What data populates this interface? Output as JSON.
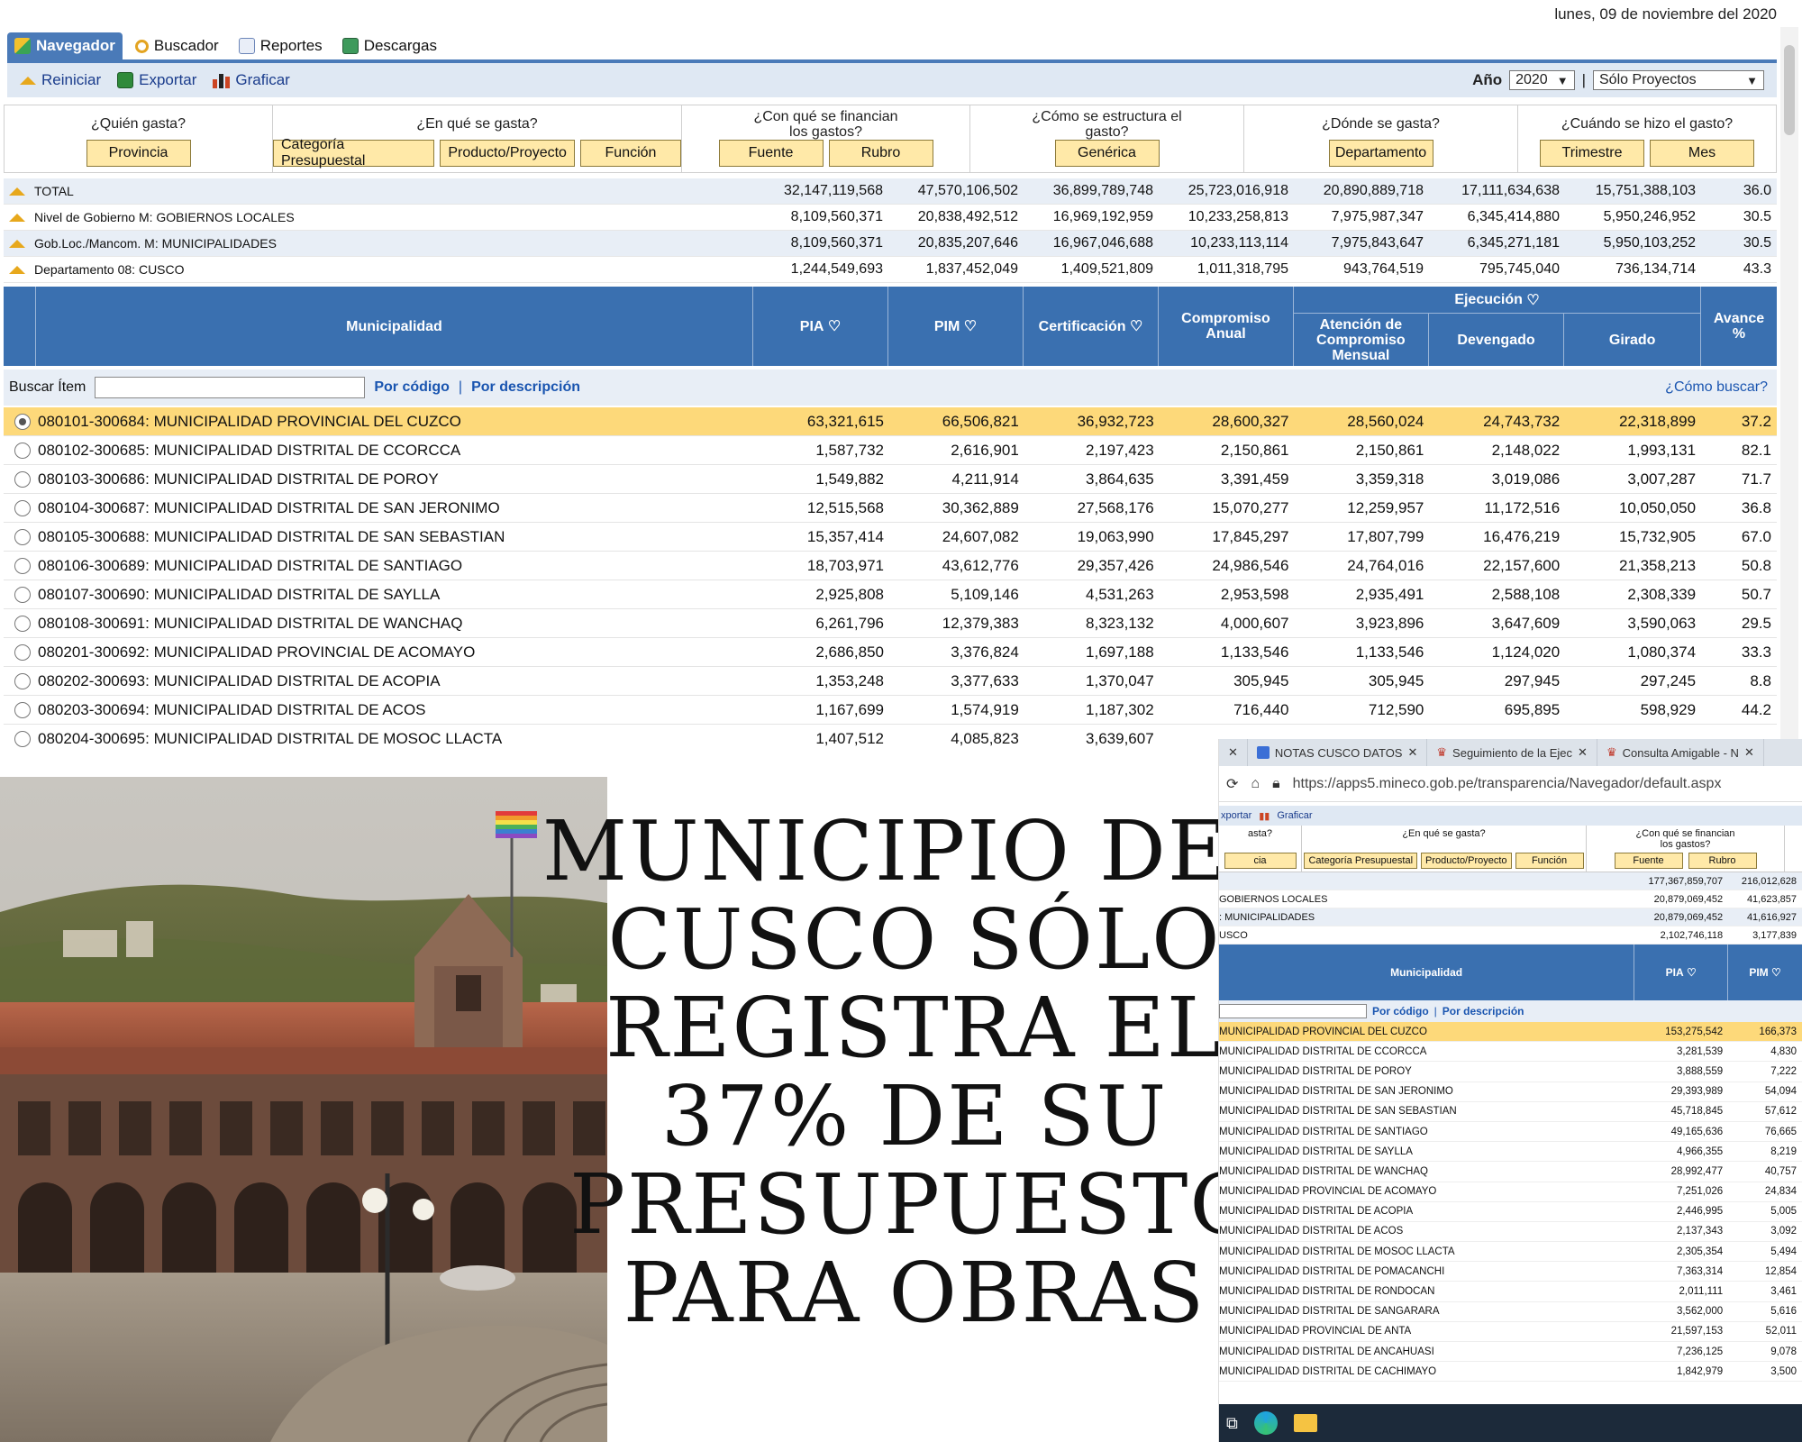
{
  "header": {
    "date": "lunes, 09 de noviembre del 2020"
  },
  "tabs": [
    "Navegador",
    "Buscador",
    "Reportes",
    "Descargas"
  ],
  "toolbar": {
    "reiniciar": "Reiniciar",
    "exportar": "Exportar",
    "graficar": "Graficar",
    "year_label": "Año",
    "year_value": "2020",
    "separator": "|",
    "scope_value": "Sólo Proyectos"
  },
  "questions": [
    {
      "title": "¿Quién gasta?",
      "buttons": [
        "Provincia"
      ]
    },
    {
      "title": "¿En qué se gasta?",
      "buttons": [
        "Categoría Presupuestal",
        "Producto/Proyecto",
        "Función"
      ]
    },
    {
      "title": "¿Con qué se financian los gastos?",
      "buttons": [
        "Fuente",
        "Rubro"
      ]
    },
    {
      "title": "¿Cómo se estructura el gasto?",
      "buttons": [
        "Genérica"
      ]
    },
    {
      "title": "¿Dónde se gasta?",
      "buttons": [
        "Departamento"
      ]
    },
    {
      "title": "¿Cuándo se hizo el gasto?",
      "buttons": [
        "Trimestre",
        "Mes"
      ]
    }
  ],
  "totals": [
    {
      "label": "TOTAL",
      "v": [
        "32,147,119,568",
        "47,570,106,502",
        "36,899,789,748",
        "25,723,016,918",
        "20,890,889,718",
        "17,111,634,638",
        "15,751,388,103",
        "36.0"
      ]
    },
    {
      "label": "Nivel de Gobierno M: GOBIERNOS LOCALES",
      "v": [
        "8,109,560,371",
        "20,838,492,512",
        "16,969,192,959",
        "10,233,258,813",
        "7,975,987,347",
        "6,345,414,880",
        "5,950,246,952",
        "30.5"
      ]
    },
    {
      "label": "Gob.Loc./Mancom. M: MUNICIPALIDADES",
      "v": [
        "8,109,560,371",
        "20,835,207,646",
        "16,967,046,688",
        "10,233,113,114",
        "7,975,843,647",
        "6,345,271,181",
        "5,950,103,252",
        "30.5"
      ]
    },
    {
      "label": "Departamento 08: CUSCO",
      "v": [
        "1,244,549,693",
        "1,837,452,049",
        "1,409,521,809",
        "1,011,318,795",
        "943,764,519",
        "795,745,040",
        "736,134,714",
        "43.3"
      ]
    }
  ],
  "table_headers": {
    "municipalidad": "Municipalidad",
    "pia": "PIA",
    "pim": "PIM",
    "certificacion": "Certificación",
    "compromiso_anual": "Compromiso Anual",
    "ejecucion": "Ejecución",
    "atencion": "Atención de Compromiso Mensual",
    "devengado": "Devengado",
    "girado": "Girado",
    "avance": "Avance %"
  },
  "search": {
    "label": "Buscar Ítem",
    "by_code": "Por código",
    "sep": "|",
    "by_desc": "Por descripción",
    "help": "¿Cómo buscar?"
  },
  "rows": [
    {
      "name": "080101-300684: MUNICIPALIDAD PROVINCIAL DEL CUZCO",
      "v": [
        "63,321,615",
        "66,506,821",
        "36,932,723",
        "28,600,327",
        "28,560,024",
        "24,743,732",
        "22,318,899",
        "37.2"
      ]
    },
    {
      "name": "080102-300685: MUNICIPALIDAD DISTRITAL DE CCORCCA",
      "v": [
        "1,587,732",
        "2,616,901",
        "2,197,423",
        "2,150,861",
        "2,150,861",
        "2,148,022",
        "1,993,131",
        "82.1"
      ]
    },
    {
      "name": "080103-300686: MUNICIPALIDAD DISTRITAL DE POROY",
      "v": [
        "1,549,882",
        "4,211,914",
        "3,864,635",
        "3,391,459",
        "3,359,318",
        "3,019,086",
        "3,007,287",
        "71.7"
      ]
    },
    {
      "name": "080104-300687: MUNICIPALIDAD DISTRITAL DE SAN JERONIMO",
      "v": [
        "12,515,568",
        "30,362,889",
        "27,568,176",
        "15,070,277",
        "12,259,957",
        "11,172,516",
        "10,050,050",
        "36.8"
      ]
    },
    {
      "name": "080105-300688: MUNICIPALIDAD DISTRITAL DE SAN SEBASTIAN",
      "v": [
        "15,357,414",
        "24,607,082",
        "19,063,990",
        "17,845,297",
        "17,807,799",
        "16,476,219",
        "15,732,905",
        "67.0"
      ]
    },
    {
      "name": "080106-300689: MUNICIPALIDAD DISTRITAL DE SANTIAGO",
      "v": [
        "18,703,971",
        "43,612,776",
        "29,357,426",
        "24,986,546",
        "24,764,016",
        "22,157,600",
        "21,358,213",
        "50.8"
      ]
    },
    {
      "name": "080107-300690: MUNICIPALIDAD DISTRITAL DE SAYLLA",
      "v": [
        "2,925,808",
        "5,109,146",
        "4,531,263",
        "2,953,598",
        "2,935,491",
        "2,588,108",
        "2,308,339",
        "50.7"
      ]
    },
    {
      "name": "080108-300691: MUNICIPALIDAD DISTRITAL DE WANCHAQ",
      "v": [
        "6,261,796",
        "12,379,383",
        "8,323,132",
        "4,000,607",
        "3,923,896",
        "3,647,609",
        "3,590,063",
        "29.5"
      ]
    },
    {
      "name": "080201-300692: MUNICIPALIDAD PROVINCIAL DE ACOMAYO",
      "v": [
        "2,686,850",
        "3,376,824",
        "1,697,188",
        "1,133,546",
        "1,133,546",
        "1,124,020",
        "1,080,374",
        "33.3"
      ]
    },
    {
      "name": "080202-300693: MUNICIPALIDAD DISTRITAL DE ACOPIA",
      "v": [
        "1,353,248",
        "3,377,633",
        "1,370,047",
        "305,945",
        "305,945",
        "297,945",
        "297,245",
        "8.8"
      ]
    },
    {
      "name": "080203-300694: MUNICIPALIDAD DISTRITAL DE ACOS",
      "v": [
        "1,167,699",
        "1,574,919",
        "1,187,302",
        "716,440",
        "712,590",
        "695,895",
        "598,929",
        "44.2"
      ]
    },
    {
      "name": "080204-300695: MUNICIPALIDAD DISTRITAL DE MOSOC LLACTA",
      "v": [
        "1,407,512",
        "4,085,823",
        "3,639,607",
        "",
        "",
        "",
        "",
        ""
      ]
    }
  ],
  "headline": [
    "MUNICIPIO DEL",
    "CUSCO SÓLO",
    "REGISTRA EL",
    "37% DE SU",
    "PRESUPUESTO",
    "PARA OBRAS"
  ],
  "browser": {
    "tabs": [
      "NOTAS CUSCO DATOS",
      "Seguimiento de la Ejec",
      "Consulta Amigable - N"
    ],
    "url": "https://apps5.mineco.gob.pe/transparencia/Navegador/default.aspx",
    "toolbar": [
      "xportar",
      "Graficar"
    ],
    "q_titles": [
      "asta?",
      "¿En qué se gasta?",
      "¿Con qué se financian los gastos?"
    ],
    "q_buttons": [
      "cia",
      "Categoría Presupuestal",
      "Producto/Proyecto",
      "Función",
      "Fuente",
      "Rubro"
    ],
    "totals": [
      {
        "label": "",
        "pia": "177,367,859,707",
        "pim": "216,012,628"
      },
      {
        "label": "GOBIERNOS LOCALES",
        "pia": "20,879,069,452",
        "pim": "41,623,857"
      },
      {
        "label": ": MUNICIPALIDADES",
        "pia": "20,879,069,452",
        "pim": "41,616,927"
      },
      {
        "label": "USCO",
        "pia": "2,102,746,118",
        "pim": "3,177,839"
      }
    ],
    "head": {
      "municipalidad": "Municipalidad",
      "pia": "PIA",
      "pim": "PIM"
    },
    "search": {
      "by_code": "Por código",
      "sep": "|",
      "by_desc": "Por descripción"
    },
    "rows": [
      {
        "name": "MUNICIPALIDAD PROVINCIAL DEL CUZCO",
        "pia": "153,275,542",
        "pim": "166,373"
      },
      {
        "name": "MUNICIPALIDAD DISTRITAL DE CCORCCA",
        "pia": "3,281,539",
        "pim": "4,830"
      },
      {
        "name": "MUNICIPALIDAD DISTRITAL DE POROY",
        "pia": "3,888,559",
        "pim": "7,222"
      },
      {
        "name": "MUNICIPALIDAD DISTRITAL DE SAN JERONIMO",
        "pia": "29,393,989",
        "pim": "54,094"
      },
      {
        "name": "MUNICIPALIDAD DISTRITAL DE SAN SEBASTIAN",
        "pia": "45,718,845",
        "pim": "57,612"
      },
      {
        "name": "MUNICIPALIDAD DISTRITAL DE SANTIAGO",
        "pia": "49,165,636",
        "pim": "76,665"
      },
      {
        "name": "MUNICIPALIDAD DISTRITAL DE SAYLLA",
        "pia": "4,966,355",
        "pim": "8,219"
      },
      {
        "name": "MUNICIPALIDAD DISTRITAL DE WANCHAQ",
        "pia": "28,992,477",
        "pim": "40,757"
      },
      {
        "name": "MUNICIPALIDAD PROVINCIAL DE ACOMAYO",
        "pia": "7,251,026",
        "pim": "24,834"
      },
      {
        "name": "MUNICIPALIDAD DISTRITAL DE ACOPIA",
        "pia": "2,446,995",
        "pim": "5,005"
      },
      {
        "name": "MUNICIPALIDAD DISTRITAL DE ACOS",
        "pia": "2,137,343",
        "pim": "3,092"
      },
      {
        "name": "MUNICIPALIDAD DISTRITAL DE MOSOC LLACTA",
        "pia": "2,305,354",
        "pim": "5,494"
      },
      {
        "name": "MUNICIPALIDAD DISTRITAL DE POMACANCHI",
        "pia": "7,363,314",
        "pim": "12,854"
      },
      {
        "name": "MUNICIPALIDAD DISTRITAL DE RONDOCAN",
        "pia": "2,011,111",
        "pim": "3,461"
      },
      {
        "name": "MUNICIPALIDAD DISTRITAL DE SANGARARA",
        "pia": "3,562,000",
        "pim": "5,616"
      },
      {
        "name": "MUNICIPALIDAD PROVINCIAL DE ANTA",
        "pia": "21,597,153",
        "pim": "52,011"
      },
      {
        "name": "MUNICIPALIDAD DISTRITAL DE ANCAHUASI",
        "pia": "7,236,125",
        "pim": "9,078"
      },
      {
        "name": "MUNICIPALIDAD DISTRITAL DE CACHIMAYO",
        "pia": "1,842,979",
        "pim": "3,500"
      }
    ]
  },
  "colors": {
    "header_blue": "#3a70b0",
    "highlight_row": "#fdd97a",
    "button_yellow": "#ffe9a8"
  }
}
